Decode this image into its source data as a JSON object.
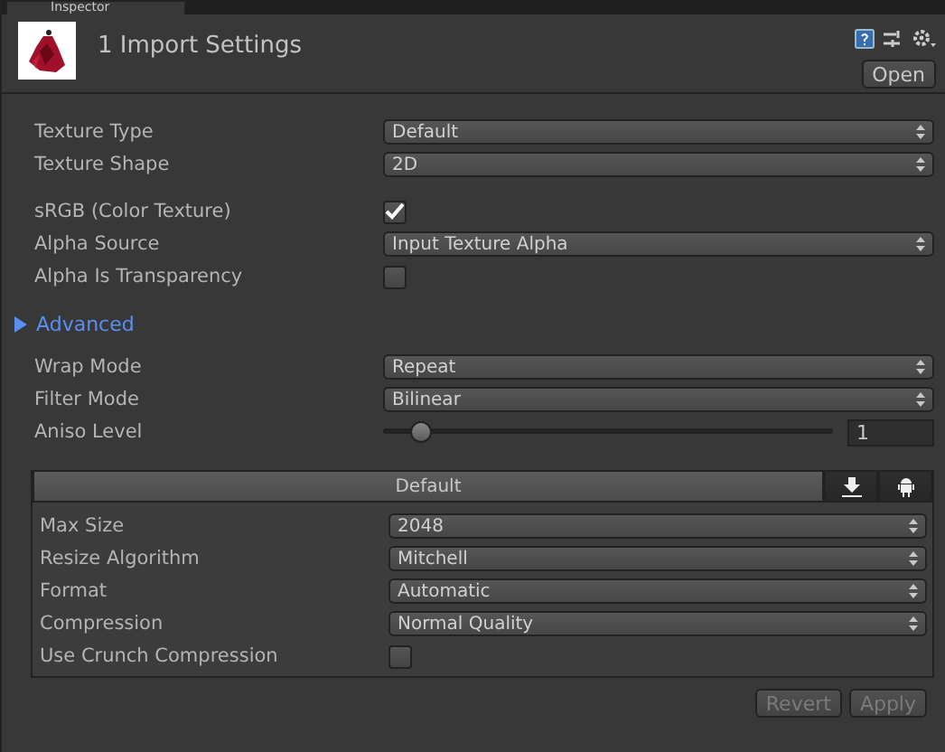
{
  "tab": {
    "label": "Inspector"
  },
  "header": {
    "title": "1 Import Settings",
    "open_button": "Open"
  },
  "groups": [
    {
      "rows": [
        {
          "kind": "dropdown",
          "label": "Texture Type",
          "value": "Default"
        },
        {
          "kind": "dropdown",
          "label": "Texture Shape",
          "value": "2D"
        }
      ]
    },
    {
      "rows": [
        {
          "kind": "checkbox",
          "label": "sRGB (Color Texture)",
          "checked": true
        },
        {
          "kind": "dropdown",
          "label": "Alpha Source",
          "value": "Input Texture Alpha"
        },
        {
          "kind": "checkbox",
          "label": "Alpha Is Transparency",
          "checked": false
        }
      ]
    }
  ],
  "advanced": {
    "label": "Advanced",
    "expanded": false
  },
  "wrap_group": {
    "rows": [
      {
        "kind": "dropdown",
        "label": "Wrap Mode",
        "value": "Repeat"
      },
      {
        "kind": "dropdown",
        "label": "Filter Mode",
        "value": "Bilinear"
      },
      {
        "kind": "slider",
        "label": "Aniso Level",
        "level": 0.0625,
        "value": "1"
      }
    ]
  },
  "platform": {
    "tabs": [
      {
        "kind": "text",
        "label": "Default",
        "selected": true
      },
      {
        "kind": "download",
        "selected": false
      },
      {
        "kind": "android",
        "selected": false
      }
    ],
    "rows": [
      {
        "kind": "dropdown",
        "label": "Max Size",
        "value": "2048"
      },
      {
        "kind": "dropdown",
        "label": "Resize Algorithm",
        "value": "Mitchell"
      },
      {
        "kind": "dropdown",
        "label": "Format",
        "value": "Automatic"
      },
      {
        "kind": "dropdown",
        "label": "Compression",
        "value": "Normal Quality"
      },
      {
        "kind": "checkbox",
        "label": "Use Crunch Compression",
        "checked": false
      }
    ]
  },
  "buttons": [
    {
      "label": "Revert",
      "disabled": true
    },
    {
      "label": "Apply",
      "disabled": true
    }
  ]
}
